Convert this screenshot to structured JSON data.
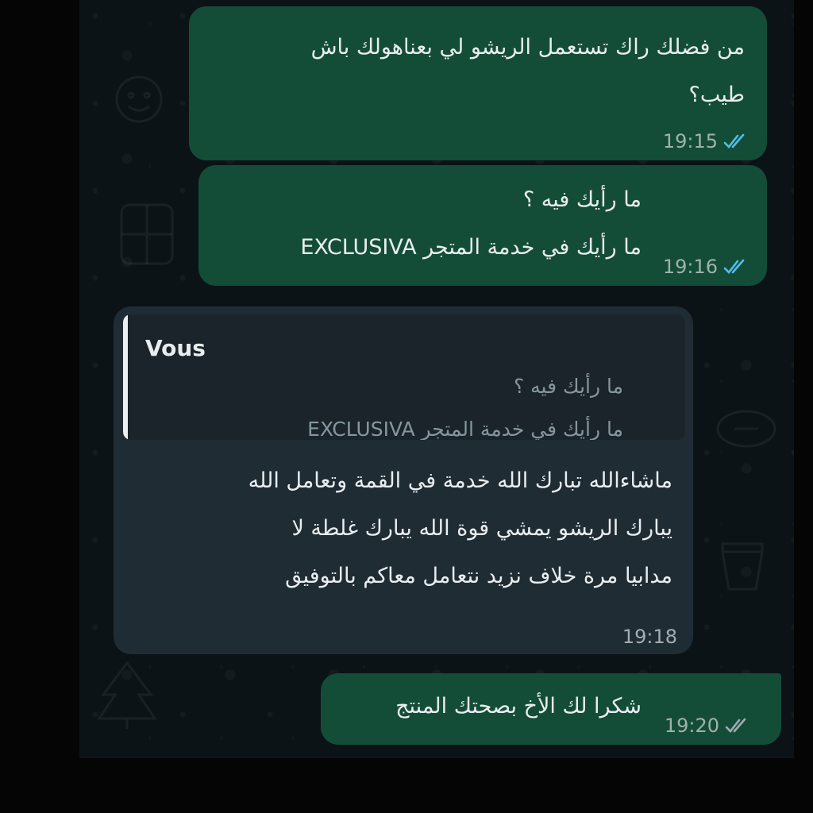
{
  "messages": [
    {
      "direction": "outgoing",
      "lines": [
        "من فضلك راك تستعمل الريشو لي بعناهولك باش",
        "طيب؟"
      ],
      "time": "19:15",
      "status": "read"
    },
    {
      "direction": "outgoing",
      "lines": [
        "ما رأيك فيه ؟",
        "ما رأيك في خدمة المتجر EXCLUSIVA"
      ],
      "time": "19:16",
      "status": "read"
    },
    {
      "direction": "incoming",
      "quote": {
        "sender": "Vous",
        "lines": [
          "ما رأيك فيه ؟",
          "ما رأيك في خدمة المتجر EXCLUSIVA"
        ]
      },
      "lines": [
        "ماشاءالله تبارك الله خدمة في القمة وتعامل الله",
        "يبارك الريشو يمشي قوة الله يبارك غلطة لا",
        "مدابيا مرة خلاف نزيد نتعامل معاكم بالتوفيق"
      ],
      "time": "19:18"
    },
    {
      "direction": "outgoing",
      "lines": [
        "شكرا لك الأخ بصحتك المنتج"
      ],
      "time": "19:20",
      "status": "delivered"
    }
  ],
  "colors": {
    "outgoing_bubble": "#144d37",
    "incoming_bubble": "#1f2c34",
    "read_ticks": "#53bdeb",
    "delivered_ticks": "#a3acb1"
  },
  "icons": [
    "double-check-read-icon",
    "double-check-delivered-icon"
  ]
}
